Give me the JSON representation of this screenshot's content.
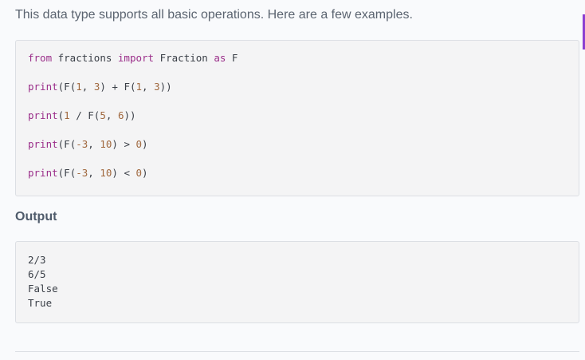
{
  "intro_text": "This data type supports all basic operations. Here are a few examples.",
  "code": {
    "line1": {
      "kw_from": "from",
      "module": " fractions ",
      "kw_import": "import",
      "cls": " Fraction ",
      "kw_as": "as",
      "alias": " F"
    },
    "line2": {
      "fn": "print",
      "a": "(F(",
      "n1": "1",
      "b": ", ",
      "n2": "3",
      "c": ") + F(",
      "n3": "1",
      "d": ", ",
      "n4": "3",
      "e": "))"
    },
    "line3": {
      "fn": "print",
      "a": "(",
      "n1": "1",
      "b": " / F(",
      "n2": "5",
      "c": ", ",
      "n3": "6",
      "d": "))"
    },
    "line4": {
      "fn": "print",
      "a": "(F(",
      "n1": "-3",
      "b": ", ",
      "n2": "10",
      "c": ") > ",
      "n3": "0",
      "d": ")"
    },
    "line5": {
      "fn": "print",
      "a": "(F(",
      "n1": "-3",
      "b": ", ",
      "n2": "10",
      "c": ") < ",
      "n3": "0",
      "d": ")"
    }
  },
  "output_heading": "Output",
  "output_lines": [
    "2/3",
    "6/5",
    "False",
    "True"
  ],
  "colors": {
    "keyword": "#9b2f8a",
    "number": "#a0683e",
    "accent": "#8c3fd1"
  }
}
